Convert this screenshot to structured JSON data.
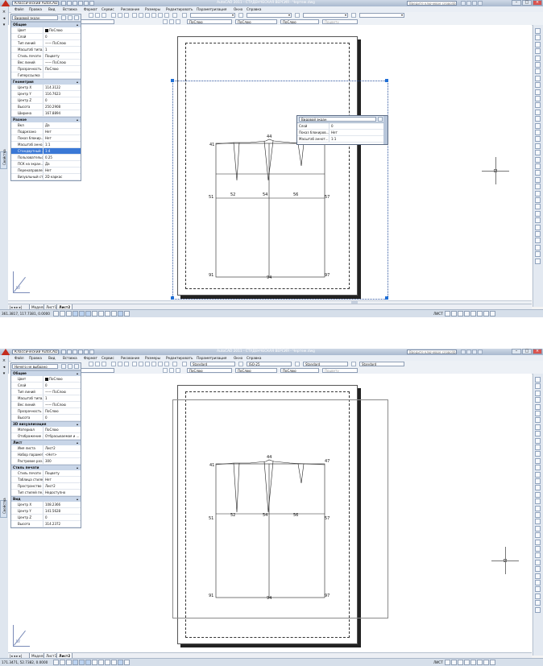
{
  "window1": {
    "title": "AutoCAD 2011 - СТУДЕНЧЕСКАЯ ВЕРСИЯ - Чертеж.dwg",
    "workspace": "Классический AutoCAD",
    "help_placeholder": "Введите ключевое слово/фразу",
    "menus": [
      "Файл",
      "Правка",
      "Вид",
      "Вставка",
      "Формат",
      "Сервис",
      "Рисование",
      "Размеры",
      "Редактировать",
      "Параметризация",
      "Окно",
      "Справка"
    ],
    "layer_value": "0",
    "combo_color": "ПоСлою",
    "combo_linetype": "ПоСлою",
    "combo_lineweight": "ПоСлою",
    "combo_plotstyle": "Поцвету",
    "palette": {
      "selector": "Видовой экран",
      "side_tab": "Свойства",
      "groups": [
        {
          "title": "Общие",
          "rows": [
            {
              "k": "Цвет",
              "v": "ПоСлою",
              "swatch": true
            },
            {
              "k": "Слой",
              "v": "0"
            },
            {
              "k": "Тип линий",
              "v": "—— ПоСлою"
            },
            {
              "k": "Масштаб типа...",
              "v": "1"
            },
            {
              "k": "Стиль печати",
              "v": "Поцвету"
            },
            {
              "k": "Вес линий",
              "v": "—— ПоСлою"
            },
            {
              "k": "Прозрачность",
              "v": "ПоСлою"
            },
            {
              "k": "Гиперссылка",
              "v": ""
            }
          ]
        },
        {
          "title": "Геометрия",
          "rows": [
            {
              "k": "Центр X",
              "v": "114.3122"
            },
            {
              "k": "Центр Y",
              "v": "116.7623"
            },
            {
              "k": "Центр Z",
              "v": "0"
            },
            {
              "k": "Высота",
              "v": "250.2908"
            },
            {
              "k": "Ширина",
              "v": "167.8894"
            }
          ]
        },
        {
          "title": "Разное",
          "rows": [
            {
              "k": "Вкл",
              "v": "Да"
            },
            {
              "k": "Подрезано",
              "v": "Нет"
            },
            {
              "k": "Показ блокир...",
              "v": "Нет"
            },
            {
              "k": "Масштаб анно...",
              "v": "1:1"
            },
            {
              "k": "Стандартный ...",
              "v": "1:4",
              "highlight": true
            },
            {
              "k": "Пользовательс...",
              "v": "0.25"
            },
            {
              "k": "ПСК на экран...",
              "v": "Да"
            },
            {
              "k": "Перенаправлен...",
              "v": "Нет"
            },
            {
              "k": "Визуальный ст...",
              "v": "2D каркас"
            }
          ]
        }
      ]
    },
    "quick_props": {
      "selector": "Видовой экран",
      "rows": [
        {
          "k": "Слой",
          "v": "0"
        },
        {
          "k": "Показ блокиров...",
          "v": "Нет"
        },
        {
          "k": "Масштаб аннот...",
          "v": "1:1"
        }
      ]
    },
    "status_coords": "361.3817, 117.7381, 0.0000",
    "status_right": "ЛИСТ"
  },
  "window2": {
    "title": "AutoCAD 2011 - СТУДЕНЧЕСКАЯ ВЕРСИЯ - Чертеж.dwg",
    "workspace": "Классический AutoCAD",
    "help_placeholder": "Введите ключевое слово/фразу",
    "menus": [
      "Файл",
      "Правка",
      "Вид",
      "Вставка",
      "Формат",
      "Сервис",
      "Рисование",
      "Размеры",
      "Редактировать",
      "Параметризация",
      "Окно",
      "Справка"
    ],
    "layer_value": "0",
    "combo_color": "ПоСлою",
    "combo_linetype": "ПоСлою",
    "combo_lineweight": "ПоСлою",
    "combo_plotstyle": "Поцвету",
    "style_text": "Standard",
    "style_dim": "ISO-25",
    "style_table": "Standard",
    "style_mleader": "Standard",
    "palette": {
      "selector": "Ничего не выбрано",
      "side_tab": "Свойства",
      "groups": [
        {
          "title": "Общие",
          "rows": [
            {
              "k": "Цвет",
              "v": "ПоСлою",
              "swatch": true
            },
            {
              "k": "Слой",
              "v": "0"
            },
            {
              "k": "Тип линий",
              "v": "—— ПоСлою"
            },
            {
              "k": "Масштаб типа...",
              "v": "1"
            },
            {
              "k": "Вес линий",
              "v": "—— ПоСлою"
            },
            {
              "k": "Прозрачность",
              "v": "ПоСлою"
            },
            {
              "k": "Высота",
              "v": "0"
            }
          ]
        },
        {
          "title": "3D визуализация",
          "rows": [
            {
              "k": "Материал",
              "v": "ПоСлою"
            },
            {
              "k": "Отображение ...",
              "v": "Отбрасываемая и ..."
            }
          ]
        },
        {
          "title": "Лист",
          "rows": [
            {
              "k": "Имя листа",
              "v": "Лист2"
            },
            {
              "k": "Набор парамет...",
              "v": "<Нет>"
            },
            {
              "k": "Растровое раз...",
              "v": "300"
            }
          ]
        },
        {
          "title": "Стиль печати",
          "rows": [
            {
              "k": "Стиль печати",
              "v": "Поцвету"
            },
            {
              "k": "Таблица стиле...",
              "v": "Нет"
            },
            {
              "k": "Пространство ...",
              "v": "Лист2"
            },
            {
              "k": "Тип стилей пе...",
              "v": "Недоступно"
            }
          ]
        },
        {
          "title": "Вид",
          "rows": [
            {
              "k": "Центр X",
              "v": "108.2366"
            },
            {
              "k": "Центр Y",
              "v": "141.5628"
            },
            {
              "k": "Центр Z",
              "v": "0"
            },
            {
              "k": "Высота",
              "v": "314.2372"
            }
          ]
        }
      ]
    },
    "status_coords": "171.3471, 52.7382, 0.0000",
    "status_right": "ЛИСТ"
  },
  "tabs": {
    "model": "Модель",
    "sheet1": "Лист1",
    "sheet2": "Лист2"
  },
  "ucs_label": "W",
  "drawing_labels": {
    "p41": "41",
    "p44": "44",
    "p47": "47",
    "p51": "51",
    "p52": "52",
    "p54": "54",
    "p56": "56",
    "p57": "57",
    "p91": "91",
    "p94": "94",
    "p97": "97"
  }
}
